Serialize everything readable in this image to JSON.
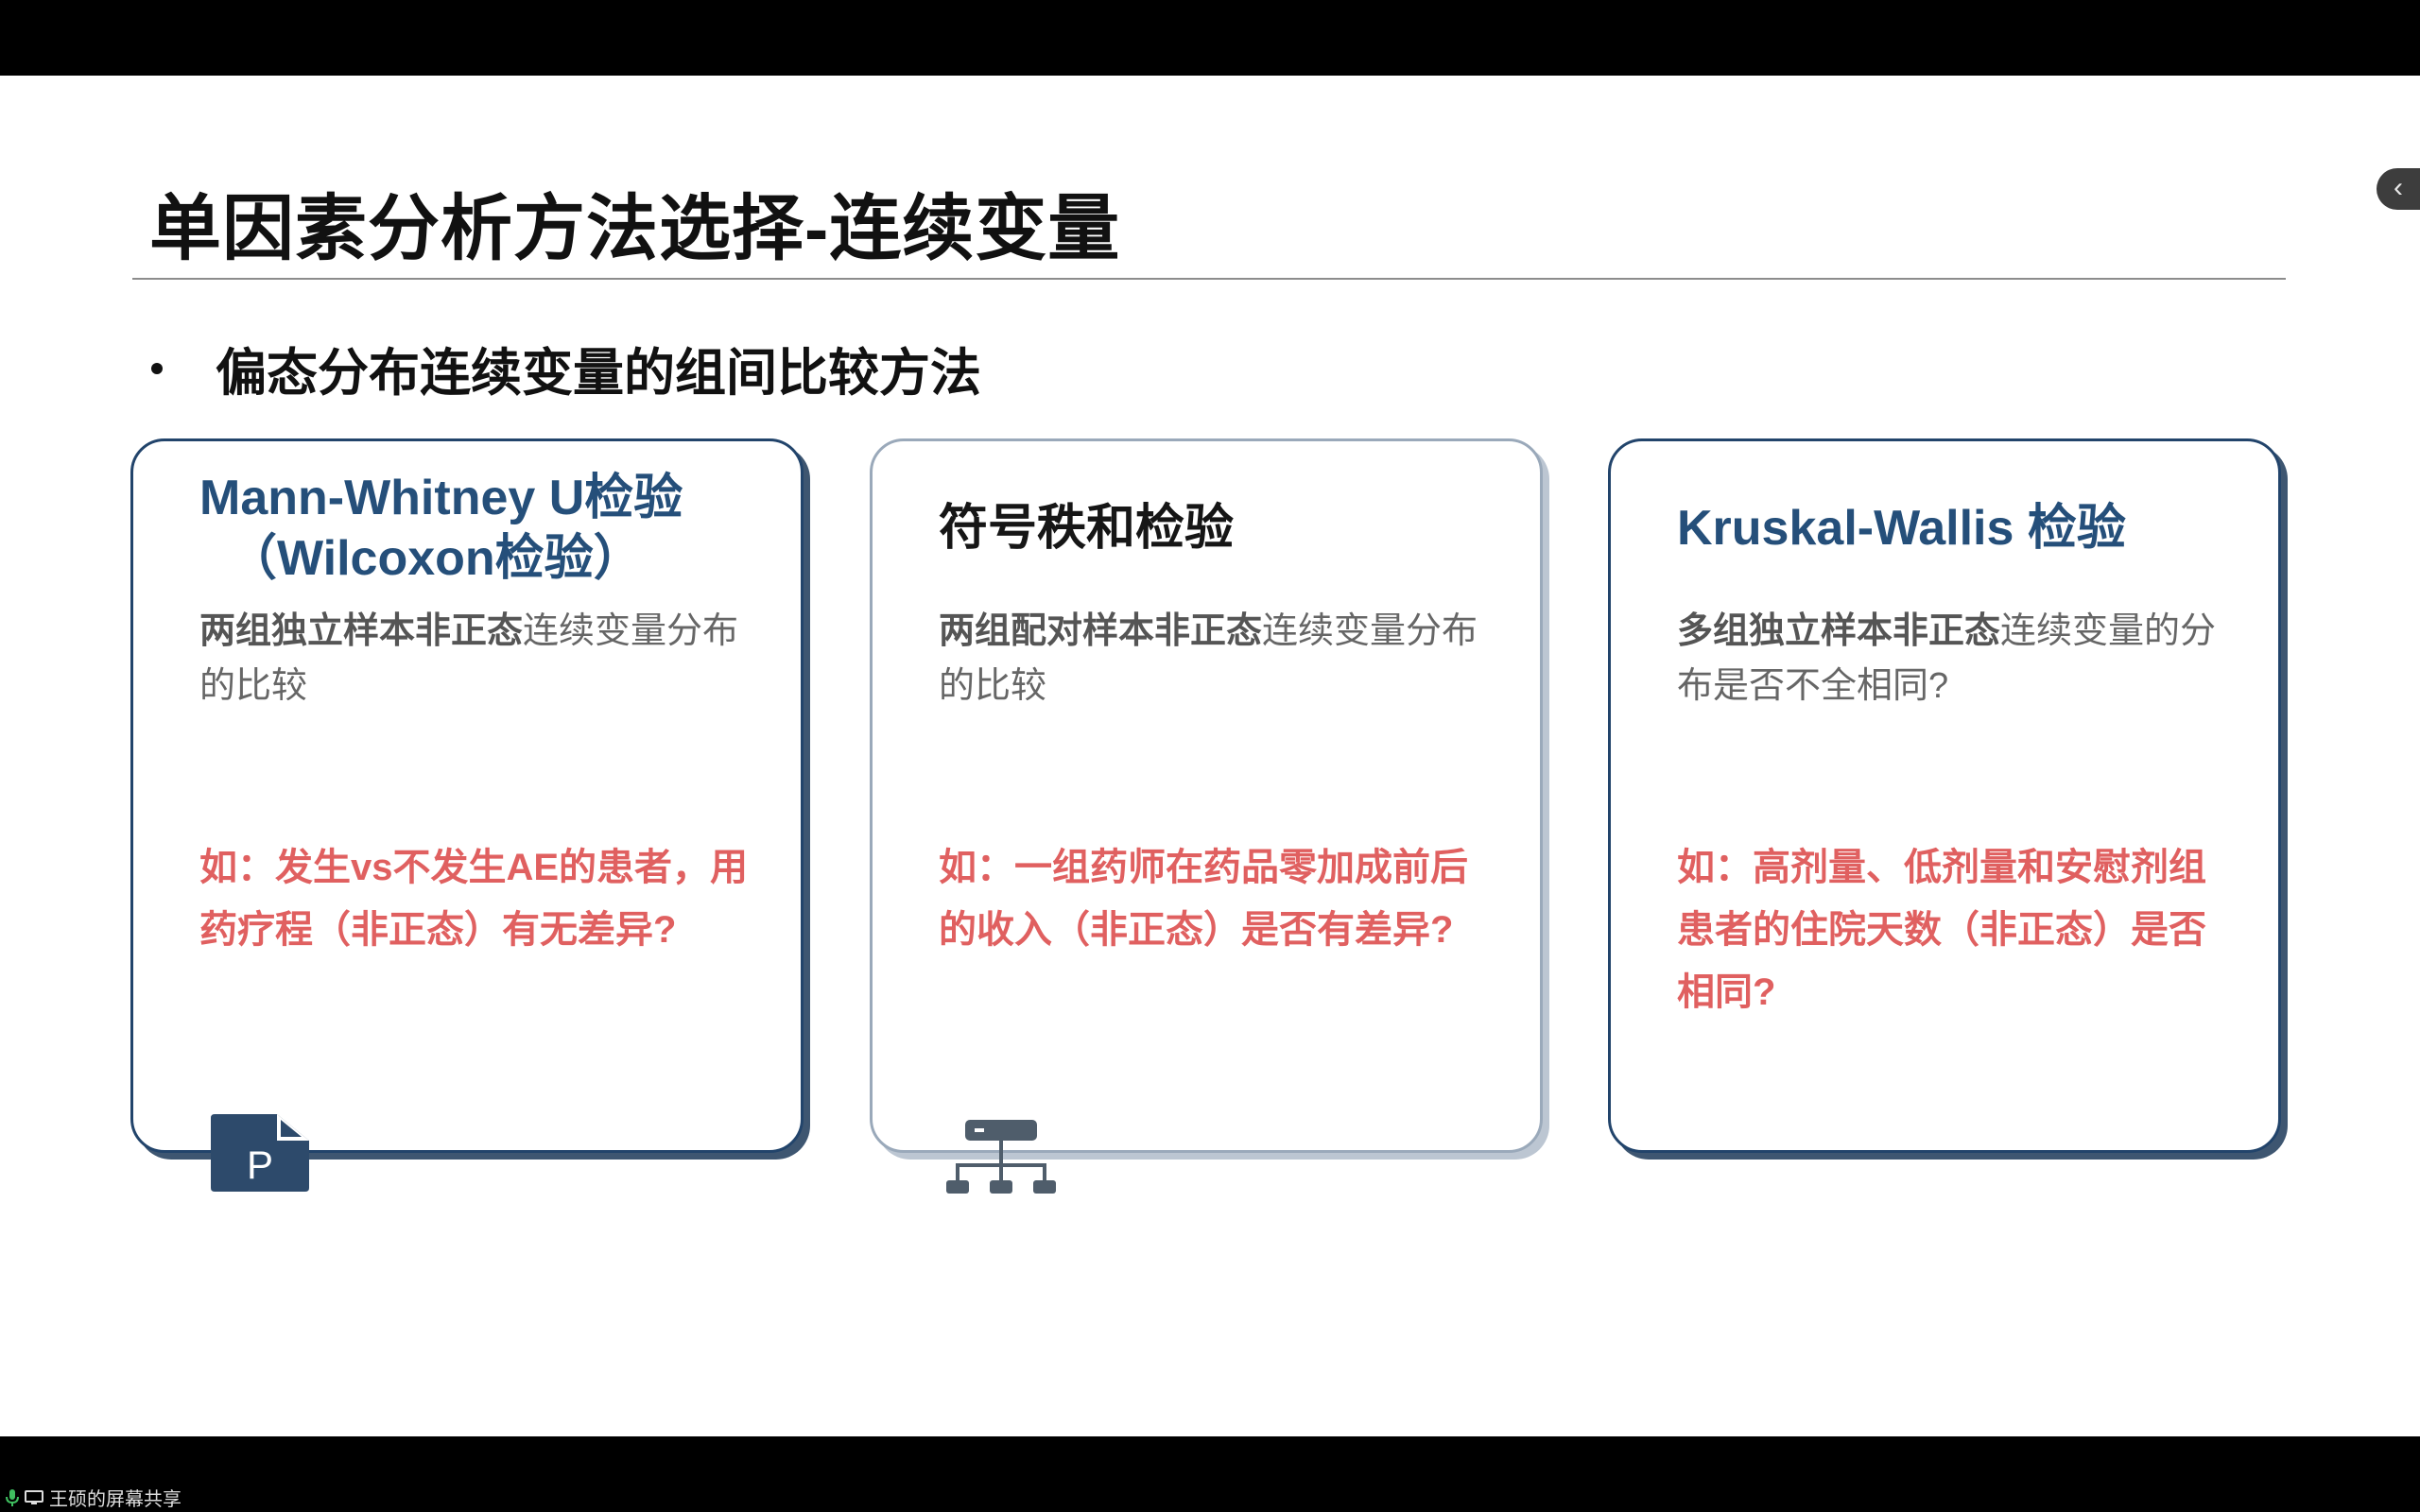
{
  "slide": {
    "title": "单因素分析方法选择-连续变量",
    "bullet": "偏态分布连续变量的组间比较方法",
    "cards": [
      {
        "title_line1": "Mann-Whitney U检验",
        "title_line2": "（Wilcoxon检验）",
        "desc_bold": "两组独立样本非正态",
        "desc_rest": "连续变量分布的比较",
        "example": "如：发生vs不发生AE的患者，用药疗程（非正态）有无差异?",
        "icon": "document-p-icon"
      },
      {
        "title_line1": "符号秩和检验",
        "desc_bold": "两组配对样本非正态",
        "desc_rest": "连续变量分布的比较",
        "example": "如：一组药师在药品零加成前后的收入（非正态）是否有差异?",
        "icon": "org-chart-icon"
      },
      {
        "title_line1": "Kruskal-Wallis 检验",
        "desc_bold": "多组独立样本非正态",
        "desc_rest": "连续变量的分布是否不全相同?",
        "example": "如：高剂量、低剂量和安慰剂组患者的住院天数（非正态）是否相同?"
      }
    ]
  },
  "side_tab": {
    "glyph": "‹"
  },
  "bottom_bar": {
    "share_label": "王硕的屏幕共享"
  },
  "colors": {
    "card_border": "#22446b",
    "card_title": "#254f7a",
    "example_red": "#e06060",
    "desc_gray": "#666666"
  }
}
